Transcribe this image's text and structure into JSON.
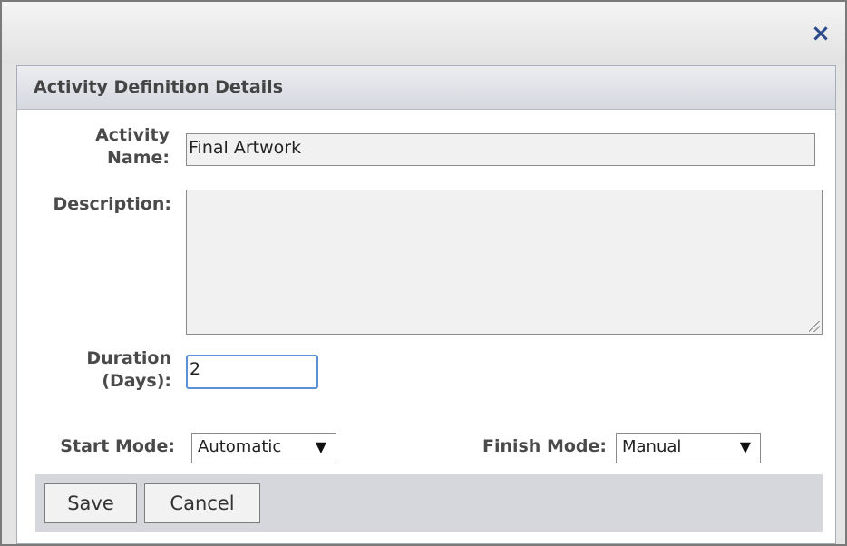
{
  "dialog": {
    "close_icon": "close-icon"
  },
  "panel": {
    "title": "Activity Definition Details"
  },
  "form": {
    "activity_name_label_line1": "Activity",
    "activity_name_label_line2": "Name:",
    "activity_name_value": "Final Artwork",
    "description_label": "Description:",
    "description_value": "",
    "duration_label_line1": "Duration",
    "duration_label_line2": "(Days):",
    "duration_value": "2",
    "start_mode_label": "Start Mode:",
    "start_mode_value": "Automatic",
    "finish_mode_label": "Finish Mode:",
    "finish_mode_value": "Manual"
  },
  "buttons": {
    "save_label": "Save",
    "cancel_label": "Cancel"
  },
  "colors": {
    "close_icon": "#2b4a8a",
    "focus_border": "#5b8fd6",
    "header_gradient_top": "#ecedf1",
    "header_gradient_bottom": "#d5d8df"
  }
}
